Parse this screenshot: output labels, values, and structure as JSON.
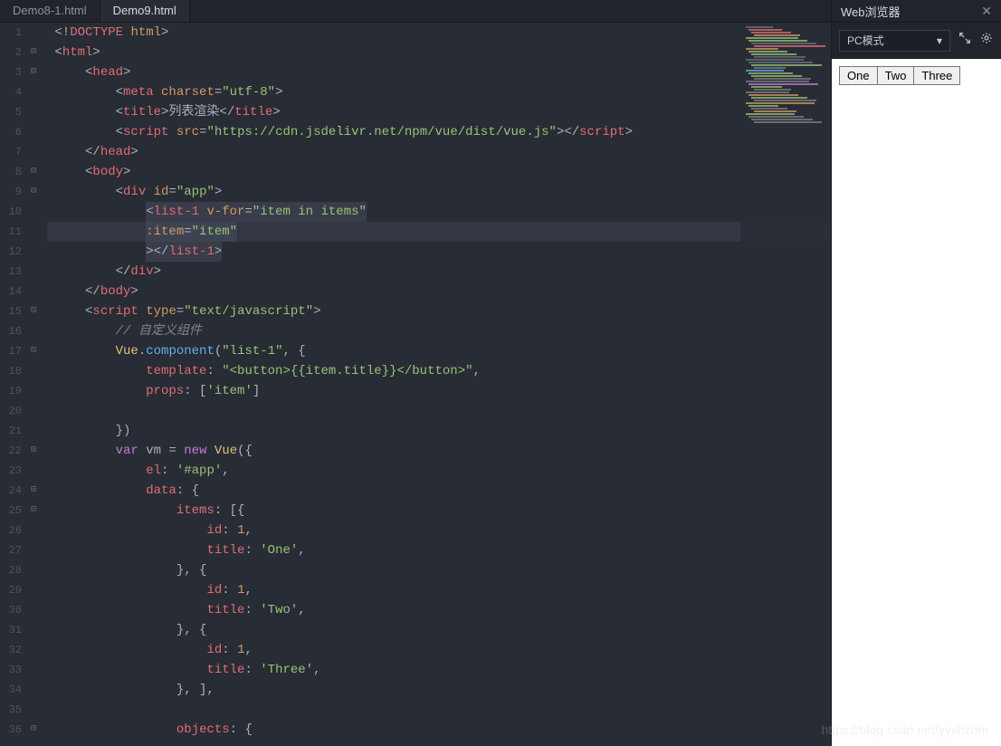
{
  "tabs": [
    {
      "label": "Demo8-1.html",
      "active": false
    },
    {
      "label": "Demo9.html",
      "active": true
    }
  ],
  "browser": {
    "title": "Web浏览器",
    "mode": "PC模式",
    "close": "✕",
    "dropdown_caret": "▾"
  },
  "preview_buttons": [
    "One",
    "Two",
    "Three"
  ],
  "watermark": "https://blog.csdn.net/yyxhzdm",
  "code": [
    {
      "n": 1,
      "fold": "",
      "hl": false,
      "tokens": [
        [
          "c-punct",
          " <!"
        ],
        [
          "c-tag",
          "DOCTYPE"
        ],
        [
          "c-punct",
          " "
        ],
        [
          "c-attr",
          "html"
        ],
        [
          "c-punct",
          ">"
        ]
      ]
    },
    {
      "n": 2,
      "fold": "⊟",
      "hl": false,
      "tokens": [
        [
          "c-punct",
          " <"
        ],
        [
          "c-tag",
          "html"
        ],
        [
          "c-punct",
          ">"
        ]
      ]
    },
    {
      "n": 3,
      "fold": "⊟",
      "hl": false,
      "tokens": [
        [
          "c-punct",
          "     <"
        ],
        [
          "c-tag",
          "head"
        ],
        [
          "c-punct",
          ">"
        ]
      ]
    },
    {
      "n": 4,
      "fold": "",
      "hl": false,
      "tokens": [
        [
          "c-punct",
          "         <"
        ],
        [
          "c-tag",
          "meta"
        ],
        [
          "c-punct",
          " "
        ],
        [
          "c-attr",
          "charset"
        ],
        [
          "c-punct",
          "="
        ],
        [
          "c-str",
          "\"utf-8\""
        ],
        [
          "c-punct",
          ">"
        ]
      ]
    },
    {
      "n": 5,
      "fold": "",
      "hl": false,
      "tokens": [
        [
          "c-punct",
          "         <"
        ],
        [
          "c-tag",
          "title"
        ],
        [
          "c-punct",
          ">列表渲染</"
        ],
        [
          "c-tag",
          "title"
        ],
        [
          "c-punct",
          ">"
        ]
      ]
    },
    {
      "n": 6,
      "fold": "",
      "hl": false,
      "tokens": [
        [
          "c-punct",
          "         <"
        ],
        [
          "c-tag",
          "script"
        ],
        [
          "c-punct",
          " "
        ],
        [
          "c-attr",
          "src"
        ],
        [
          "c-punct",
          "="
        ],
        [
          "c-str",
          "\"https://cdn.jsdelivr.net/npm/vue/dist/vue.js\""
        ],
        [
          "c-punct",
          "></"
        ],
        [
          "c-tag",
          "script"
        ],
        [
          "c-punct",
          ">"
        ]
      ]
    },
    {
      "n": 7,
      "fold": "",
      "hl": false,
      "tokens": [
        [
          "c-punct",
          "     </"
        ],
        [
          "c-tag",
          "head"
        ],
        [
          "c-punct",
          ">"
        ]
      ]
    },
    {
      "n": 8,
      "fold": "⊟",
      "hl": false,
      "tokens": [
        [
          "c-punct",
          "     <"
        ],
        [
          "c-tag",
          "body"
        ],
        [
          "c-punct",
          ">"
        ]
      ]
    },
    {
      "n": 9,
      "fold": "⊟",
      "hl": false,
      "tokens": [
        [
          "c-punct",
          "         <"
        ],
        [
          "c-tag",
          "div"
        ],
        [
          "c-punct",
          " "
        ],
        [
          "c-attr",
          "id"
        ],
        [
          "c-punct",
          "="
        ],
        [
          "c-str",
          "\"app\""
        ],
        [
          "c-punct",
          ">"
        ]
      ]
    },
    {
      "n": 10,
      "fold": "",
      "hl": false,
      "box": true,
      "tokens": [
        [
          "c-punct",
          "             "
        ],
        [
          "c-punct",
          "<"
        ],
        [
          "c-tag",
          "list-1"
        ],
        [
          "c-punct",
          " "
        ],
        [
          "c-attr",
          "v-for"
        ],
        [
          "c-punct",
          "="
        ],
        [
          "c-str",
          "\"item in items\""
        ]
      ]
    },
    {
      "n": 11,
      "fold": "",
      "hl": true,
      "box": true,
      "tokens": [
        [
          "c-punct",
          "             "
        ],
        [
          "c-attr",
          ":item"
        ],
        [
          "c-punct",
          "="
        ],
        [
          "c-str",
          "\"item\""
        ]
      ]
    },
    {
      "n": 12,
      "fold": "",
      "hl": false,
      "box": true,
      "tokens": [
        [
          "c-punct",
          "             "
        ],
        [
          "c-punct",
          "></"
        ],
        [
          "c-tag",
          "list-1"
        ],
        [
          "c-punct",
          ">"
        ]
      ]
    },
    {
      "n": 13,
      "fold": "",
      "hl": false,
      "tokens": [
        [
          "c-punct",
          "         </"
        ],
        [
          "c-tag",
          "div"
        ],
        [
          "c-punct",
          ">"
        ]
      ]
    },
    {
      "n": 14,
      "fold": "",
      "hl": false,
      "tokens": [
        [
          "c-punct",
          "     </"
        ],
        [
          "c-tag",
          "body"
        ],
        [
          "c-punct",
          ">"
        ]
      ]
    },
    {
      "n": 15,
      "fold": "⊟",
      "hl": false,
      "tokens": [
        [
          "c-punct",
          "     <"
        ],
        [
          "c-tag",
          "script"
        ],
        [
          "c-punct",
          " "
        ],
        [
          "c-attr",
          "type"
        ],
        [
          "c-punct",
          "="
        ],
        [
          "c-str",
          "\"text/javascript\""
        ],
        [
          "c-punct",
          ">"
        ]
      ]
    },
    {
      "n": 16,
      "fold": "",
      "hl": false,
      "tokens": [
        [
          "c-com",
          "         // 自定义组件"
        ]
      ]
    },
    {
      "n": 17,
      "fold": "⊟",
      "hl": false,
      "tokens": [
        [
          "c-punct",
          "         "
        ],
        [
          "c-var",
          "Vue"
        ],
        [
          "c-punct",
          "."
        ],
        [
          "c-fn",
          "component"
        ],
        [
          "c-punct",
          "("
        ],
        [
          "c-str",
          "\"list-1\""
        ],
        [
          "c-punct",
          ", {"
        ]
      ]
    },
    {
      "n": 18,
      "fold": "",
      "hl": false,
      "tokens": [
        [
          "c-punct",
          "             "
        ],
        [
          "c-prop",
          "template"
        ],
        [
          "c-punct",
          ": "
        ],
        [
          "c-str",
          "\"<button>{{item.title}}</button>\""
        ],
        [
          "c-punct",
          ","
        ]
      ]
    },
    {
      "n": 19,
      "fold": "",
      "hl": false,
      "tokens": [
        [
          "c-punct",
          "             "
        ],
        [
          "c-prop",
          "props"
        ],
        [
          "c-punct",
          ": ["
        ],
        [
          "c-str",
          "'item'"
        ],
        [
          "c-punct",
          "]"
        ]
      ]
    },
    {
      "n": 20,
      "fold": "",
      "hl": false,
      "tokens": [
        [
          "c-punct",
          ""
        ]
      ]
    },
    {
      "n": 21,
      "fold": "",
      "hl": false,
      "tokens": [
        [
          "c-punct",
          "         })"
        ]
      ]
    },
    {
      "n": 22,
      "fold": "⊟",
      "hl": false,
      "tokens": [
        [
          "c-punct",
          "         "
        ],
        [
          "c-kw",
          "var"
        ],
        [
          "c-punct",
          " vm = "
        ],
        [
          "c-kw",
          "new"
        ],
        [
          "c-punct",
          " "
        ],
        [
          "c-var",
          "Vue"
        ],
        [
          "c-punct",
          "({"
        ]
      ]
    },
    {
      "n": 23,
      "fold": "",
      "hl": false,
      "tokens": [
        [
          "c-punct",
          "             "
        ],
        [
          "c-prop",
          "el"
        ],
        [
          "c-punct",
          ": "
        ],
        [
          "c-str",
          "'#app'"
        ],
        [
          "c-punct",
          ","
        ]
      ]
    },
    {
      "n": 24,
      "fold": "⊟",
      "hl": false,
      "tokens": [
        [
          "c-punct",
          "             "
        ],
        [
          "c-prop",
          "data"
        ],
        [
          "c-punct",
          ": {"
        ]
      ]
    },
    {
      "n": 25,
      "fold": "⊟",
      "hl": false,
      "tokens": [
        [
          "c-punct",
          "                 "
        ],
        [
          "c-prop",
          "items"
        ],
        [
          "c-punct",
          ": [{"
        ]
      ]
    },
    {
      "n": 26,
      "fold": "",
      "hl": false,
      "tokens": [
        [
          "c-punct",
          "                     "
        ],
        [
          "c-prop",
          "id"
        ],
        [
          "c-punct",
          ": "
        ],
        [
          "c-num",
          "1"
        ],
        [
          "c-punct",
          ","
        ]
      ]
    },
    {
      "n": 27,
      "fold": "",
      "hl": false,
      "tokens": [
        [
          "c-punct",
          "                     "
        ],
        [
          "c-prop",
          "title"
        ],
        [
          "c-punct",
          ": "
        ],
        [
          "c-str",
          "'One'"
        ],
        [
          "c-punct",
          ","
        ]
      ]
    },
    {
      "n": 28,
      "fold": "",
      "hl": false,
      "tokens": [
        [
          "c-punct",
          "                 }, {"
        ]
      ]
    },
    {
      "n": 29,
      "fold": "",
      "hl": false,
      "tokens": [
        [
          "c-punct",
          "                     "
        ],
        [
          "c-prop",
          "id"
        ],
        [
          "c-punct",
          ": "
        ],
        [
          "c-num",
          "1"
        ],
        [
          "c-punct",
          ","
        ]
      ]
    },
    {
      "n": 30,
      "fold": "",
      "hl": false,
      "tokens": [
        [
          "c-punct",
          "                     "
        ],
        [
          "c-prop",
          "title"
        ],
        [
          "c-punct",
          ": "
        ],
        [
          "c-str",
          "'Two'"
        ],
        [
          "c-punct",
          ","
        ]
      ]
    },
    {
      "n": 31,
      "fold": "",
      "hl": false,
      "tokens": [
        [
          "c-punct",
          "                 }, {"
        ]
      ]
    },
    {
      "n": 32,
      "fold": "",
      "hl": false,
      "tokens": [
        [
          "c-punct",
          "                     "
        ],
        [
          "c-prop",
          "id"
        ],
        [
          "c-punct",
          ": "
        ],
        [
          "c-num",
          "1"
        ],
        [
          "c-punct",
          ","
        ]
      ]
    },
    {
      "n": 33,
      "fold": "",
      "hl": false,
      "tokens": [
        [
          "c-punct",
          "                     "
        ],
        [
          "c-prop",
          "title"
        ],
        [
          "c-punct",
          ": "
        ],
        [
          "c-str",
          "'Three'"
        ],
        [
          "c-punct",
          ","
        ]
      ]
    },
    {
      "n": 34,
      "fold": "",
      "hl": false,
      "tokens": [
        [
          "c-punct",
          "                 }, ],"
        ]
      ]
    },
    {
      "n": 35,
      "fold": "",
      "hl": false,
      "tokens": [
        [
          "c-punct",
          ""
        ]
      ]
    },
    {
      "n": 36,
      "fold": "⊟",
      "hl": false,
      "tokens": [
        [
          "c-punct",
          "                 "
        ],
        [
          "c-prop",
          "objects"
        ],
        [
          "c-punct",
          ": {"
        ]
      ]
    }
  ],
  "minimap_colors": [
    "#6b7280",
    "#e06c75",
    "#e06c75",
    "#d19a66",
    "#98c379",
    "#98c379",
    "#6b7280",
    "#e06c75",
    "#d19a66",
    "#98c379",
    "#98c379",
    "#6b7280",
    "#6b7280",
    "#6b7280",
    "#98c379",
    "#7f848e",
    "#61afef",
    "#98c379",
    "#98c379",
    "#808080",
    "#808080",
    "#c678dd",
    "#98c379",
    "#808080",
    "#808080",
    "#d19a66",
    "#98c379",
    "#808080",
    "#d19a66",
    "#98c379",
    "#808080",
    "#d19a66",
    "#98c379",
    "#808080",
    "#808080",
    "#808080"
  ]
}
